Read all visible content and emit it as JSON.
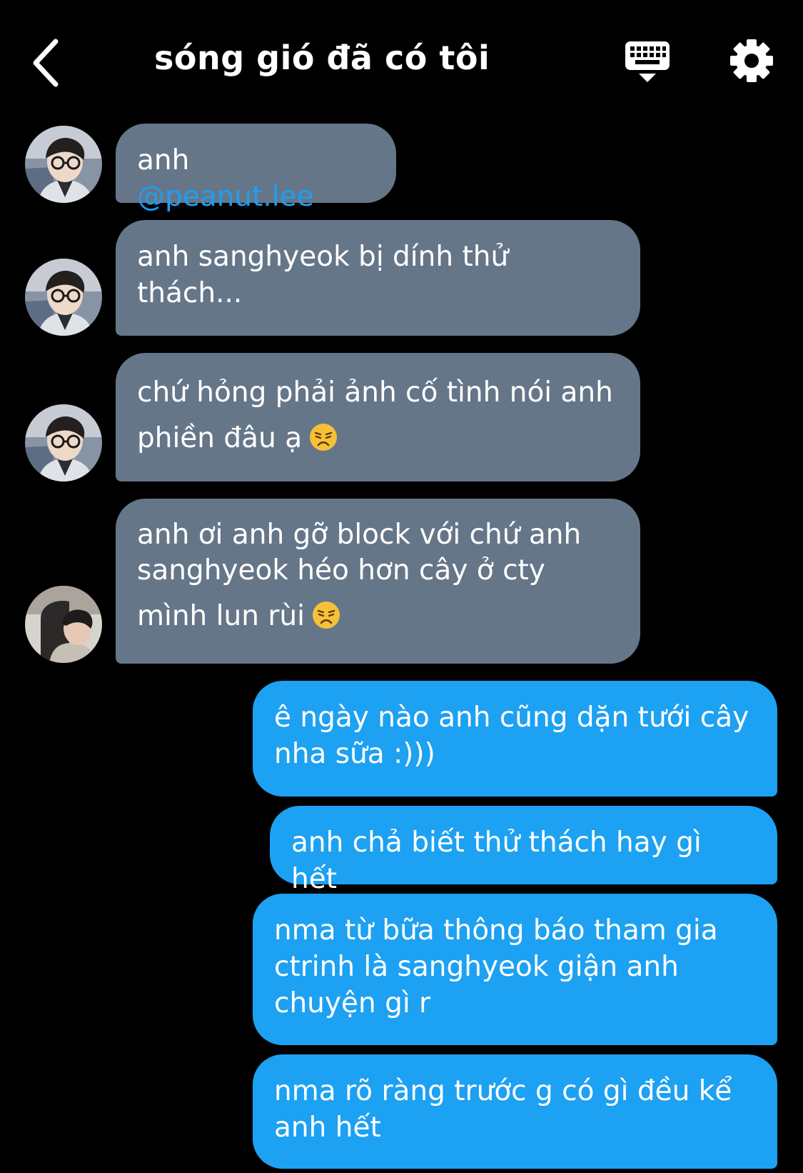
{
  "header": {
    "title": "sóng gió đã có tôi",
    "back_icon": "chevron-left-icon",
    "keyboard_icon": "keyboard-icon",
    "settings_icon": "gear-icon"
  },
  "messages": {
    "m1": {
      "prefix": "anh ",
      "mention": "@peanut.lee"
    },
    "m2": {
      "line1": "anh sanghyeok bị dính thử",
      "line2": "thách..."
    },
    "m3": {
      "line1": "chứ hỏng phải ảnh cố tình nói anh",
      "line2": "phiền đâu ạ",
      "emoji": "disappointed-face-icon"
    },
    "m4": {
      "line1": "anh ơi anh gỡ block với chứ anh",
      "line2": "sanghyeok héo hơn cây ở cty",
      "line3": "mình lun rùi",
      "emoji": "disappointed-face-icon"
    },
    "m5": {
      "line1": "ê ngày nào anh cũng dặn tưới cây",
      "line2": "nha sữa :)))"
    },
    "m6": {
      "line1": "anh chả biết thử thách hay gì hết"
    },
    "m7": {
      "line1": "nma từ bữa thông báo tham gia",
      "line2": "ctrinh là sanghyeok giận anh",
      "line3": "chuyện gì r"
    },
    "m8": {
      "line1": "nma rõ ràng trước g có gì đều kể",
      "line2": "anh hết"
    }
  },
  "colors": {
    "incoming": "#667689",
    "outgoing": "#1da1f2",
    "mention": "#1e9ef0",
    "background": "#000000"
  }
}
